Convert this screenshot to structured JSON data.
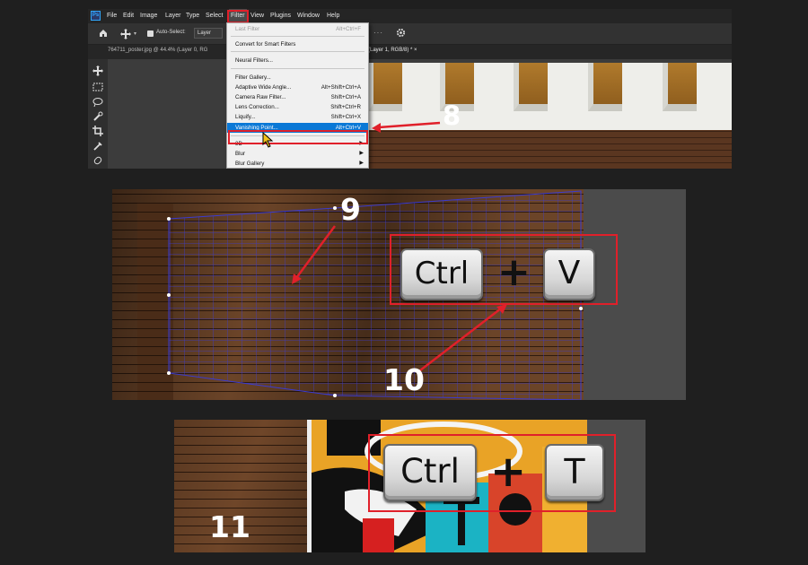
{
  "photoshop": {
    "logo": "Ps",
    "menu": [
      "File",
      "Edit",
      "Image",
      "Layer",
      "Type",
      "Select",
      "Filter",
      "View",
      "Plugins",
      "Window",
      "Help"
    ],
    "active_menu": "Filter",
    "options_bar": {
      "auto_select_label": "Auto-Select:",
      "layer_select_value": "Layer",
      "dots": "···"
    },
    "tabs": {
      "doc1": "764711_poster.jpg @ 44.4% (Layer 0, RG",
      "doc2": "(Layer 1, RGB/8) * ×"
    },
    "filter_menu": {
      "last_filter": {
        "label": "Last Filter",
        "shortcut": "Alt+Ctrl+F"
      },
      "convert": "Convert for Smart Filters",
      "neural": "Neural Filters...",
      "gallery": "Filter Gallery...",
      "adaptive": {
        "label": "Adaptive Wide Angle...",
        "shortcut": "Alt+Shift+Ctrl+A"
      },
      "camera_raw": {
        "label": "Camera Raw Filter...",
        "shortcut": "Shift+Ctrl+A"
      },
      "lens": {
        "label": "Lens Correction...",
        "shortcut": "Shift+Ctrl+R"
      },
      "liquify": {
        "label": "Liquify...",
        "shortcut": "Shift+Ctrl+X"
      },
      "vanishing": {
        "label": "Vanishing Point...",
        "shortcut": "Alt+Ctrl+V"
      },
      "three_d": "3D",
      "blur": "Blur",
      "blur_gallery": "Blur Gallery"
    }
  },
  "step_numbers": {
    "eight": "8",
    "nine": "9",
    "ten": "10",
    "eleven": "11"
  },
  "shortcut_paste": {
    "key1": "Ctrl",
    "plus": "+",
    "key2": "V"
  },
  "shortcut_transform": {
    "key1": "Ctrl",
    "plus": "+",
    "key2": "T"
  },
  "colors": {
    "highlight": "#e0202a",
    "selected": "#0a78d6",
    "grid": "#3b3bd0"
  }
}
